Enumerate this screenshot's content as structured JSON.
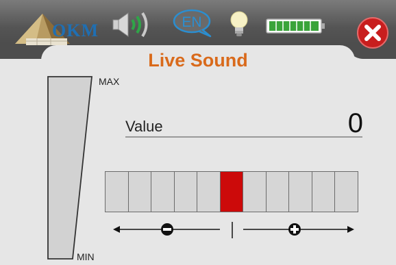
{
  "header": {
    "logo_text": "OKM",
    "language": "EN",
    "icons": [
      "okm-logo",
      "speaker-volume-icon",
      "language-speech-bubble-icon",
      "light-bulb-icon",
      "battery-icon",
      "close-icon"
    ]
  },
  "title": "Live Sound",
  "gauge": {
    "max_label": "MAX",
    "min_label": "MIN"
  },
  "value": {
    "label": "Value",
    "number": "0"
  },
  "balance": {
    "segments": 11,
    "active_index": 5
  },
  "colors": {
    "title": "#d96a1b",
    "active_segment": "#cc0a0a",
    "close_button": "#c81e1e",
    "battery": "#3aa43a"
  }
}
